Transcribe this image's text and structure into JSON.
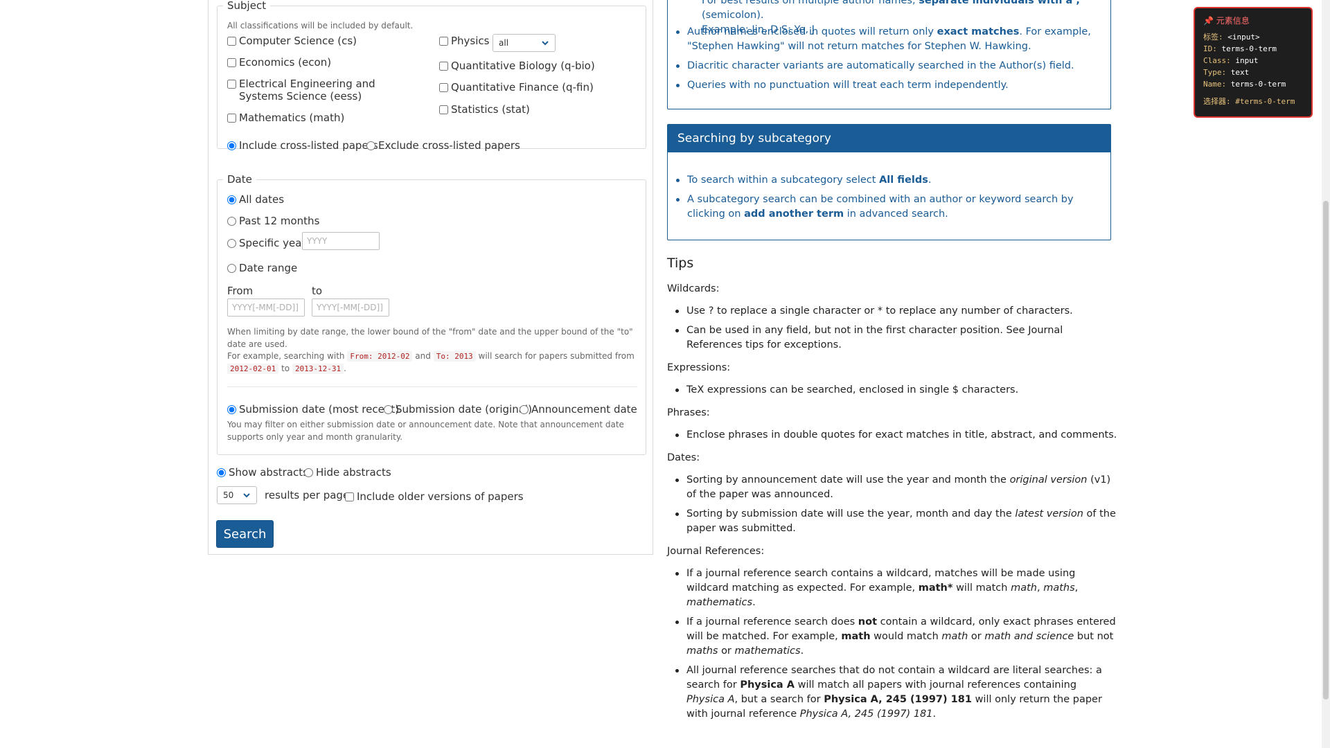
{
  "subject": {
    "legend": "Subject",
    "hint": "All classifications will be included by default.",
    "categories": [
      {
        "label": "Computer Science (cs)"
      },
      {
        "label": "Economics (econ)"
      },
      {
        "label": "Electrical Engineering and Systems Science (eess)"
      },
      {
        "label": "Mathematics (math)"
      },
      {
        "label": "Physics"
      },
      {
        "label": "Quantitative Biology (q-bio)"
      },
      {
        "label": "Quantitative Finance (q-fin)"
      },
      {
        "label": "Statistics (stat)"
      }
    ],
    "physics_select_value": "all",
    "crosslist": {
      "include_label": "Include cross-listed papers",
      "exclude_label": "Exclude cross-listed papers",
      "selected": "include"
    }
  },
  "date": {
    "legend": "Date",
    "options": [
      {
        "label": "All dates",
        "checked": true
      },
      {
        "label": "Past 12 months",
        "checked": false
      },
      {
        "label": "Specific year",
        "checked": false
      },
      {
        "label": "Date range",
        "checked": false
      }
    ],
    "year_placeholder": "YYYY",
    "from_label": "From",
    "to_label": "to",
    "from_placeholder": "YYYY[-MM[-DD]]",
    "to_placeholder": "YYYY[-MM[-DD]]",
    "note_1": "When limiting by date range, the lower bound of the \"from\" date and the upper bound of the \"to\" date are used.",
    "note_2_prefix": "For example, searching with",
    "note_2_from": "From: 2012-02",
    "note_2_and": "and",
    "note_2_to": "To: 2013",
    "note_2_mid": "will search for papers submitted from",
    "note_2_start": "2012-02-01",
    "note_2_to_word": "to",
    "note_2_end": "2013-12-31",
    "note_2_period": ".",
    "date_types": [
      {
        "label": "Submission date (most recent)",
        "checked": true
      },
      {
        "label": "Submission date (original)",
        "checked": false
      },
      {
        "label": "Announcement date",
        "checked": false
      }
    ],
    "date_type_hint": "You may filter on either submission date or announcement date. Note that announcement date supports only year and month granularity."
  },
  "abstracts": {
    "show_label": "Show abstracts",
    "hide_label": "Hide abstracts",
    "selected": "show"
  },
  "results": {
    "per_page_value": "50",
    "per_page_label": "results per page",
    "older_versions_label": "Include older versions of papers"
  },
  "search_button": "Search",
  "author_help": {
    "partial_line_1": "For best results on multiple author names,",
    "partial_bold": "separate individuals with a ;",
    "partial_tail": "(semicolon).",
    "partial_line_2": "Example: Jin, D S; Ye, J",
    "items": [
      {
        "pre": "Author names enclosed in quotes will return only",
        "bold": "exact matches",
        "post": ". For example, \"Stephen Hawking\" will not return matches for Stephen W. Hawking."
      },
      {
        "pre": "Diacritic character variants are automatically searched in the Author(s) field.",
        "bold": "",
        "post": ""
      },
      {
        "pre": "Queries with no punctuation will treat each term independently.",
        "bold": "",
        "post": ""
      }
    ]
  },
  "subcategory_help": {
    "title": "Searching by subcategory",
    "item_1_pre": "To search within a subcategory select",
    "item_1_bold": "All fields",
    "item_1_post": ".",
    "item_2_pre": "A subcategory search can be combined with an author or keyword search by clicking on",
    "item_2_bold": "add another term",
    "item_2_post": "in advanced search."
  },
  "tips": {
    "title": "Tips",
    "wildcards_heading": "Wildcards:",
    "wildcards": [
      "Use ? to replace a single character or * to replace any number of characters.",
      "Can be used in any field, but not in the first character position. See Journal References tips for exceptions."
    ],
    "expressions_heading": "Expressions:",
    "expressions": [
      "TeX expressions can be searched, enclosed in single $ characters."
    ],
    "phrases_heading": "Phrases:",
    "phrases": [
      "Enclose phrases in double quotes for exact matches in title, abstract, and comments."
    ],
    "dates_heading": "Dates:",
    "dates_1_pre": "Sorting by announcement date will use the year and month the",
    "dates_1_em": "original version",
    "dates_1_post": "(v1) of the paper was announced.",
    "dates_2_pre": "Sorting by submission date will use the year, month and day the",
    "dates_2_em": "latest version",
    "dates_2_post": "of the paper was submitted.",
    "journal_heading": "Journal References:",
    "jr1_a": "If a journal reference search contains a wildcard, matches will be made using wildcard matching as expected. For example,",
    "jr1_b": "math*",
    "jr1_c": "will match",
    "jr1_d": "math",
    "jr1_e": ",",
    "jr1_f": "maths",
    "jr1_g": ",",
    "jr1_h": "mathematics",
    "jr1_i": ".",
    "jr2_a": "If a journal reference search does",
    "jr2_b": "not",
    "jr2_c": "contain a wildcard, only exact phrases entered will be matched. For example,",
    "jr2_d": "math",
    "jr2_e": "would match",
    "jr2_f": "math",
    "jr2_g": "or",
    "jr2_h": "math and science",
    "jr2_i": "but not",
    "jr2_j": "maths",
    "jr2_k": "or",
    "jr2_l": "mathematics",
    "jr2_m": ".",
    "jr3_a": "All journal reference searches that do not contain a wildcard are literal searches: a search for",
    "jr3_b": "Physica A",
    "jr3_c": "will match all papers with journal references containing",
    "jr3_d": "Physica A",
    "jr3_e": ", but a search for",
    "jr3_f": "Physica A, 245 (1997) 181",
    "jr3_g": "will only return the paper with journal reference",
    "jr3_h": "Physica A, 245 (1997) 181",
    "jr3_i": "."
  },
  "element_info": {
    "title": "元素信息",
    "tag_key": "标签:",
    "tag_val": "<input>",
    "id_key": "ID:",
    "id_val": "terms-0-term",
    "class_key": "Class:",
    "class_val": "input",
    "type_key": "Type:",
    "type_val": "text",
    "name_key": "Name:",
    "name_val": "terms-0-term",
    "selector_key": "选择器:",
    "selector_val": "#terms-0-term"
  },
  "colors": {
    "brand_blue": "#1a5c96",
    "code_red": "#b21f1f",
    "tooltip_border": "#e03131"
  }
}
